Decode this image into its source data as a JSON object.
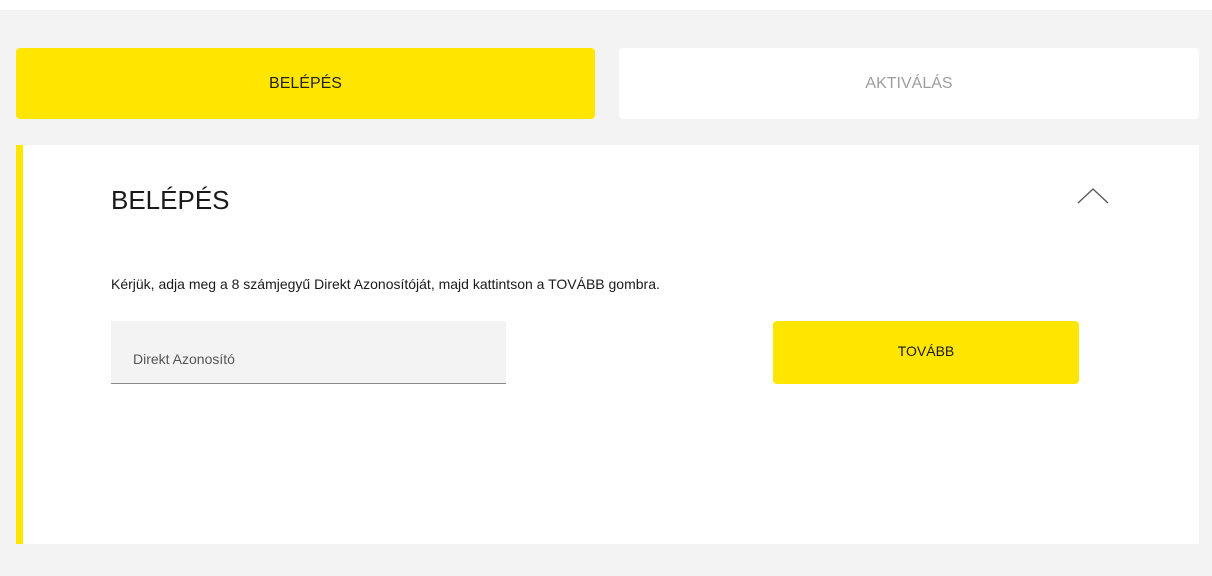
{
  "tabs": {
    "login_label": "BELÉPÉS",
    "activate_label": "AKTIVÁLÁS"
  },
  "panel": {
    "title": "BELÉPÉS",
    "instruction": "Kérjük, adja meg a 8 számjegyű Direkt Azonosítóját, majd kattintson a TOVÁBB gombra.",
    "id_input": {
      "value": "",
      "placeholder": "Direkt Azonosító"
    },
    "next_label": "TOVÁBB",
    "collapse_icon": "chevron-up-icon"
  },
  "colors": {
    "accent": "#ffe600",
    "background": "#f3f3f3",
    "panel": "#ffffff",
    "inactive_text": "#9e9e9e"
  }
}
